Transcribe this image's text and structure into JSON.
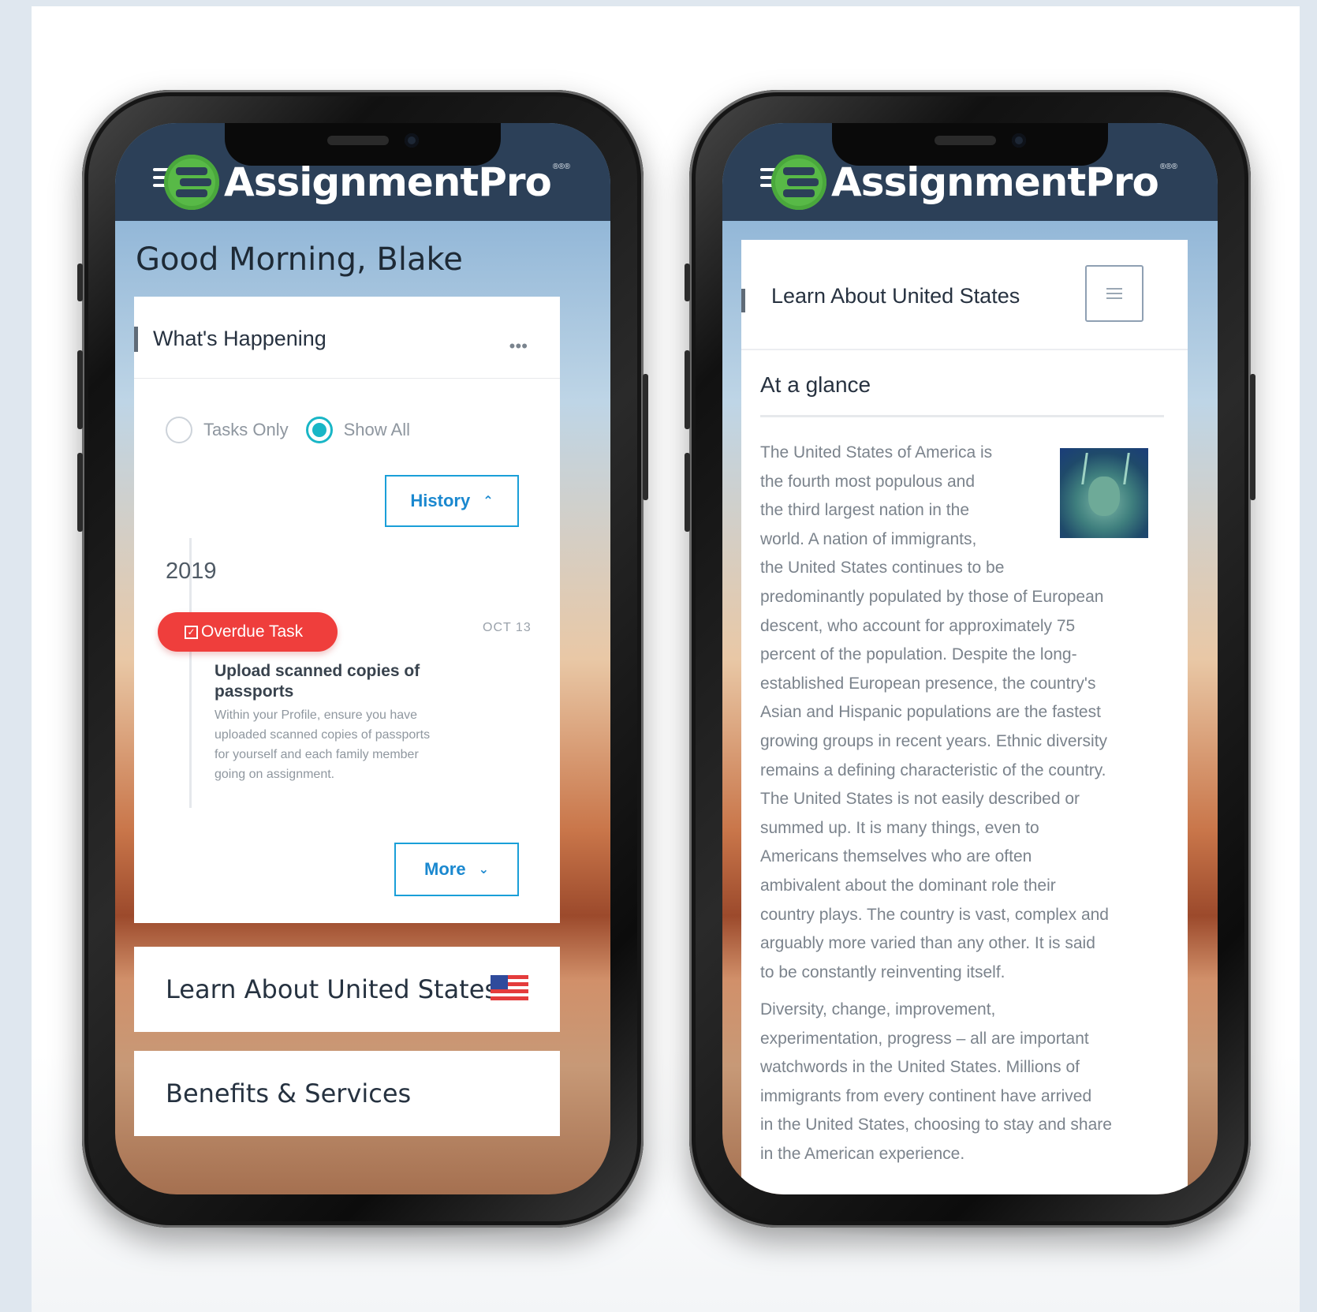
{
  "colors": {
    "appbar": "#2c4058",
    "brand_green": "#58b947",
    "accent_teal": "#19b6c6",
    "link_blue": "#1a88cf",
    "overdue_red": "#ef3e3c"
  },
  "brand": {
    "name": "AssignmentPro",
    "trademark": "®®®"
  },
  "left_phone": {
    "greeting": "Good Morning, Blake",
    "whats_happening": {
      "title": "What's Happening",
      "more_icon": "ellipsis-icon",
      "filter": {
        "options": [
          "Tasks Only",
          "Show All"
        ],
        "selected": "Show All"
      },
      "history_button": {
        "label": "History",
        "icon": "chevron-up-icon"
      },
      "year": "2019",
      "task": {
        "badge": "Overdue Task",
        "badge_icon": "edit-icon",
        "date": "OCT 13",
        "title": "Upload scanned copies of passports",
        "description": "Within your Profile, ensure you have uploaded scanned copies of passports for yourself and each family member going on assignment."
      },
      "more_button": {
        "label": "More",
        "icon": "chevron-down-icon"
      }
    },
    "learn_card": {
      "label": "Learn About United States",
      "icon": "us-flag-icon"
    },
    "benefits_card": {
      "label": "Benefits & Services"
    }
  },
  "right_phone": {
    "header_title": "Learn About United States",
    "menu_icon": "hamburger-icon",
    "section_title": "At a glance",
    "image": "statue-of-liberty",
    "paragraph1_lines": [
      "The United States of America is",
      "the fourth most populous and",
      "the third largest nation in the",
      "world. A nation of immigrants,",
      "the United States continues to be",
      "predominantly populated by those of European",
      "descent, who account for approximately 75",
      "percent of the population. Despite the long-",
      "established European presence, the country's",
      "Asian and Hispanic populations are the fastest",
      "growing groups in recent years. Ethnic diversity",
      "remains a defining characteristic of the country.",
      "The United States is not easily described or",
      "summed up. It is many things, even to",
      "Americans themselves who are often",
      "ambivalent about the dominant role their",
      "country plays. The country is vast, complex and",
      "arguably more varied than any other. It is said",
      "to be constantly reinventing itself."
    ],
    "paragraph2_lines": [
      "Diversity, change, improvement,",
      "experimentation, progress – all are important",
      "watchwords in the United States. Millions of",
      "immigrants from every continent have arrived",
      "in the United States, choosing to stay and share",
      "in the American experience."
    ]
  }
}
